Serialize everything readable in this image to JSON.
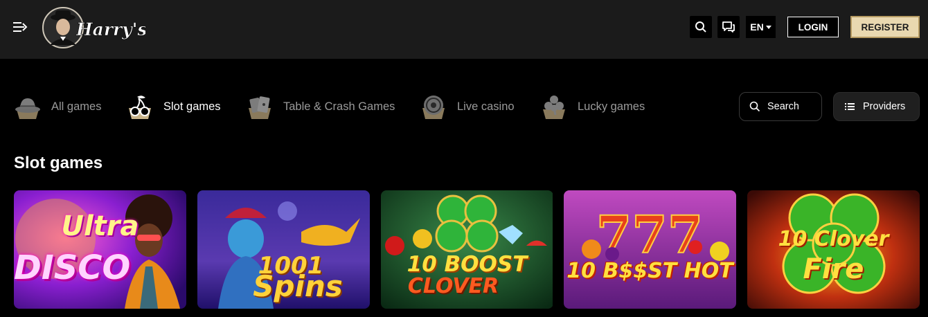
{
  "header": {
    "brand": "Harry's",
    "language": "EN",
    "login_label": "LOGIN",
    "register_label": "REGISTER"
  },
  "categories": [
    {
      "label": "All games",
      "icon": "hat-icon",
      "active": false
    },
    {
      "label": "Slot games",
      "icon": "cherries-icon",
      "active": true
    },
    {
      "label": "Table & Crash Games",
      "icon": "cards-icon",
      "active": false
    },
    {
      "label": "Live casino",
      "icon": "roulette-icon",
      "active": false
    },
    {
      "label": "Lucky games",
      "icon": "clover-icon",
      "active": false
    }
  ],
  "search_label": "Search",
  "providers_label": "Providers",
  "section_title": "Slot games",
  "games": [
    {
      "title_line1": "Ultra",
      "title_line2": "DISCO"
    },
    {
      "title_line1": "1001",
      "title_line2": "Spins"
    },
    {
      "title_line1": "10 BOOST",
      "title_line2": "CLOVER"
    },
    {
      "title_line1": "10 B$$ST HOT",
      "title_line2": ""
    },
    {
      "title_line1": "10 Clover",
      "title_line2": "Fire"
    }
  ],
  "colors": {
    "header_bg": "#1b1b1b",
    "page_bg": "#000000",
    "register_bg": "#e9d8b0",
    "inactive_text": "#9a9a9a",
    "icon_tan": "#c9b48a"
  }
}
